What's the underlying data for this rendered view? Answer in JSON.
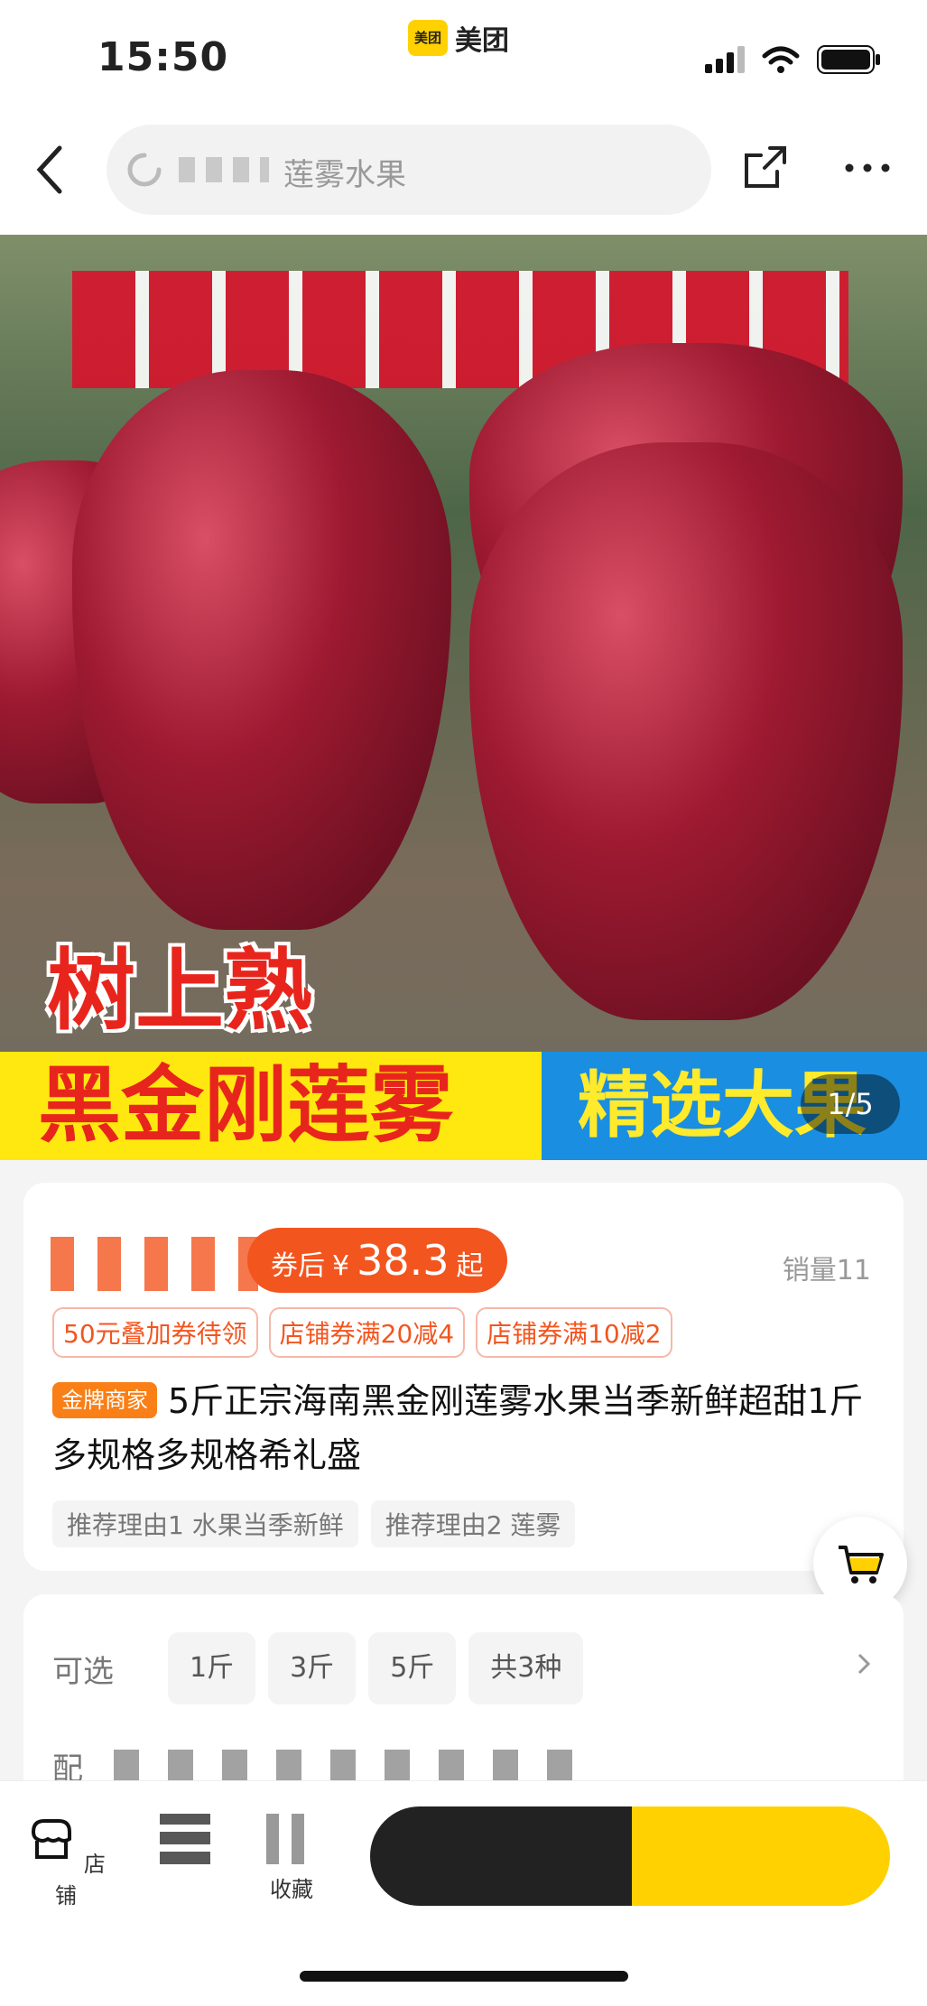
{
  "status_bar": {
    "time": "15:50",
    "app_name": "美团",
    "app_logo_text": "美团"
  },
  "search": {
    "value": "莲雾水果"
  },
  "hero": {
    "ripe_text": "树上熟",
    "banner_left": "黑金刚莲雾",
    "banner_right": "精选大果",
    "pager": "1/5"
  },
  "product": {
    "price_prefix": "券后",
    "currency": "¥",
    "price": "38.3",
    "price_suffix": "起",
    "sales": "销量11",
    "coupons": [
      "50元叠加券待领",
      "店铺券满20减4",
      "店铺券满10减2"
    ],
    "badge": "金牌商家",
    "title": "5斤正宗海南黑金刚莲雾水果当季新鲜超甜1斤多规格多规格希礼盛",
    "reasons": [
      "推荐理由1 水果当季新鲜",
      "推荐理由2 莲雾"
    ]
  },
  "specs": {
    "label": "可选",
    "options": [
      "1斤",
      "3斤",
      "5斤",
      "共3种"
    ],
    "label2": "配"
  },
  "bottom_bar": {
    "items": [
      "店铺",
      "",
      "收藏"
    ]
  },
  "colors": {
    "accent": "#f3551f",
    "brand_yellow": "#ffd100"
  }
}
